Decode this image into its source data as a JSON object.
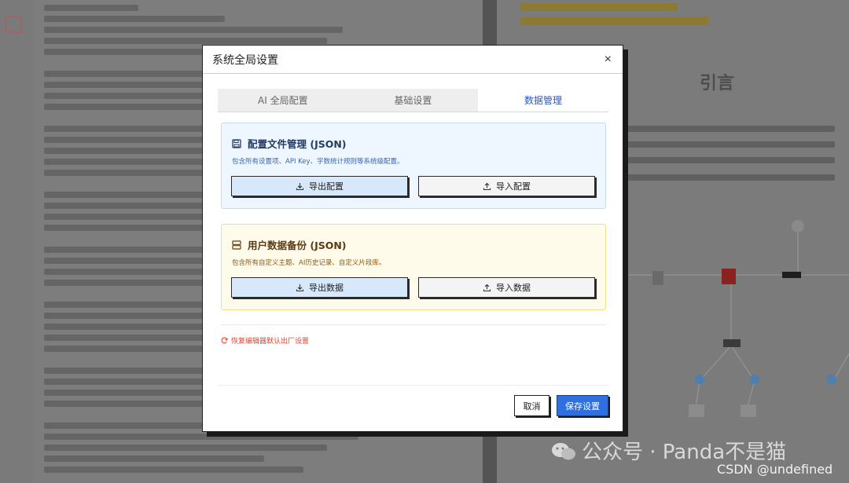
{
  "dialog": {
    "title": "系统全局设置",
    "close_symbol": "×"
  },
  "tabs": [
    {
      "label": "AI 全局配置",
      "active": false
    },
    {
      "label": "基础设置",
      "active": false
    },
    {
      "label": "数据管理",
      "active": true
    }
  ],
  "config_section": {
    "icon": "save-disk-icon",
    "title": "配置文件管理 (JSON)",
    "description": "包含所有设置项、API Key、字数统计规则等系统级配置。",
    "export_label": "导出配置",
    "import_label": "导入配置",
    "accent": "#eef6ff"
  },
  "data_section": {
    "icon": "database-icon",
    "title": "用户数据备份 (JSON)",
    "description": "包含所有自定义主题、AI历史记录、自定义片段库。",
    "export_label": "导出数据",
    "import_label": "导入数据",
    "accent": "#fffbea"
  },
  "reset_link": "恢复编辑器默认出厂设置",
  "footer": {
    "cancel_label": "取消",
    "save_label": "保存设置"
  },
  "background": {
    "preview_heading": "引言",
    "watermark": "公众号 · Panda不是猫",
    "credit": "CSDN @undefined"
  },
  "colors": {
    "primary": "#2f6fe0",
    "danger": "#e0442f",
    "active_tab": "#2d57b8"
  }
}
